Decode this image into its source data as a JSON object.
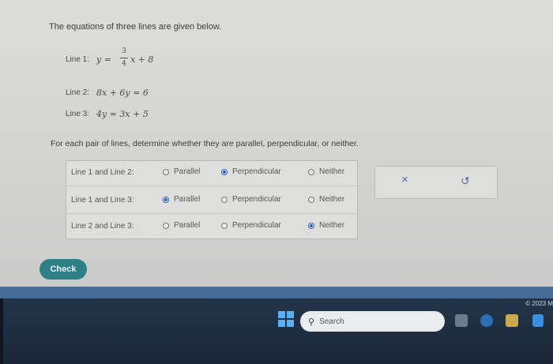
{
  "question": "The equations of three lines are given below.",
  "lines": [
    {
      "label": "Line 1:",
      "lhs": "y =",
      "frac_num": "3",
      "frac_den": "4",
      "rhs": "x + 8"
    },
    {
      "label": "Line 2:",
      "equation": "8x + 6y = 6"
    },
    {
      "label": "Line 3:",
      "equation": "4y = 3x + 5"
    }
  ],
  "instruction": "For each pair of lines, determine whether they are parallel, perpendicular, or neither.",
  "options": [
    "Parallel",
    "Perpendicular",
    "Neither"
  ],
  "pairs": [
    {
      "label": "Line 1 and Line 2:",
      "selected": "Perpendicular"
    },
    {
      "label": "Line 1 and Line 3:",
      "selected": "Parallel"
    },
    {
      "label": "Line 2 and Line 3:",
      "selected": "Neither"
    }
  ],
  "actions": {
    "clear": "×",
    "undo": "↺"
  },
  "check_label": "Check",
  "taskbar": {
    "search_placeholder": "Search",
    "copyright": "© 2023 M"
  },
  "colors": {
    "accent": "#2f7f86",
    "radio_selected": "#2a5bbf"
  }
}
